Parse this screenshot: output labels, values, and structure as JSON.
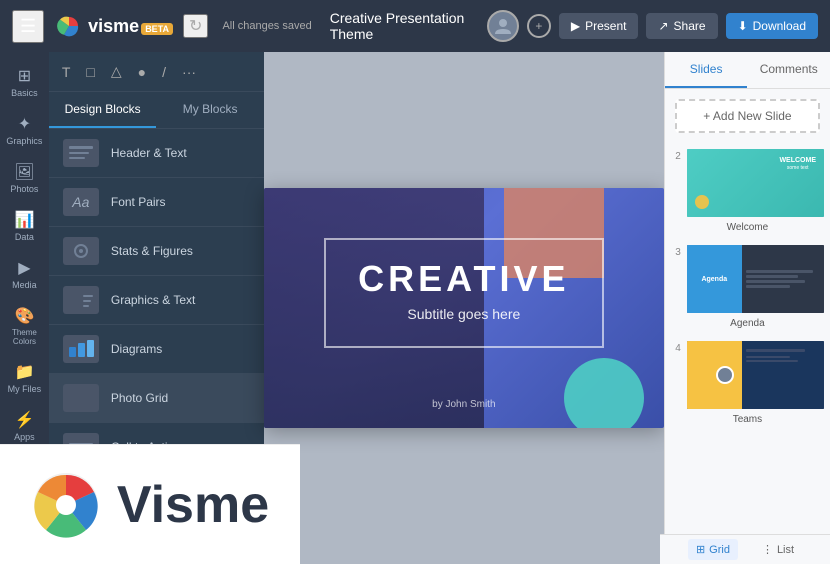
{
  "app": {
    "name": "visme",
    "beta": "BETA"
  },
  "topbar": {
    "saved_text": "All changes saved",
    "title": "Creative Presentation Theme",
    "present_label": "Present",
    "share_label": "Share",
    "download_label": "Download"
  },
  "toolbar": {
    "tools": [
      "T",
      "□",
      "△",
      "●",
      "/",
      "..."
    ]
  },
  "blocks_panel": {
    "tab_design": "Design Blocks",
    "tab_my": "My Blocks",
    "items": [
      {
        "label": "Header & Text",
        "icon": "≡"
      },
      {
        "label": "Font Pairs",
        "icon": "Aa"
      },
      {
        "label": "Stats & Figures",
        "icon": "◉"
      },
      {
        "label": "Graphics & Text",
        "icon": "⊞"
      },
      {
        "label": "Diagrams",
        "icon": "⊟"
      },
      {
        "label": "Photo Grid",
        "icon": "⊡"
      },
      {
        "label": "Call to Action",
        "icon": "≣"
      }
    ]
  },
  "icon_sidebar": {
    "items": [
      {
        "symbol": "⊞",
        "label": "Basics"
      },
      {
        "symbol": "✦",
        "label": "Graphics"
      },
      {
        "symbol": "🖼",
        "label": "Photos"
      },
      {
        "symbol": "📊",
        "label": "Data"
      },
      {
        "symbol": "▶",
        "label": "Media"
      },
      {
        "symbol": "🎨",
        "label": "Theme Colors"
      },
      {
        "symbol": "📁",
        "label": "My Files"
      },
      {
        "symbol": "⚡",
        "label": "Apps"
      }
    ]
  },
  "slide": {
    "title": "CREATIVE",
    "subtitle": "Subtitle goes here",
    "author": "by John Smith"
  },
  "right_panel": {
    "tab_slides": "Slides",
    "tab_comments": "Comments",
    "add_slide_label": "+ Add New Slide",
    "slides": [
      {
        "num": "2",
        "label": "Welcome"
      },
      {
        "num": "3",
        "label": "Agenda"
      },
      {
        "num": "4",
        "label": "Teams"
      }
    ],
    "view_grid": "Grid",
    "view_list": "List"
  }
}
